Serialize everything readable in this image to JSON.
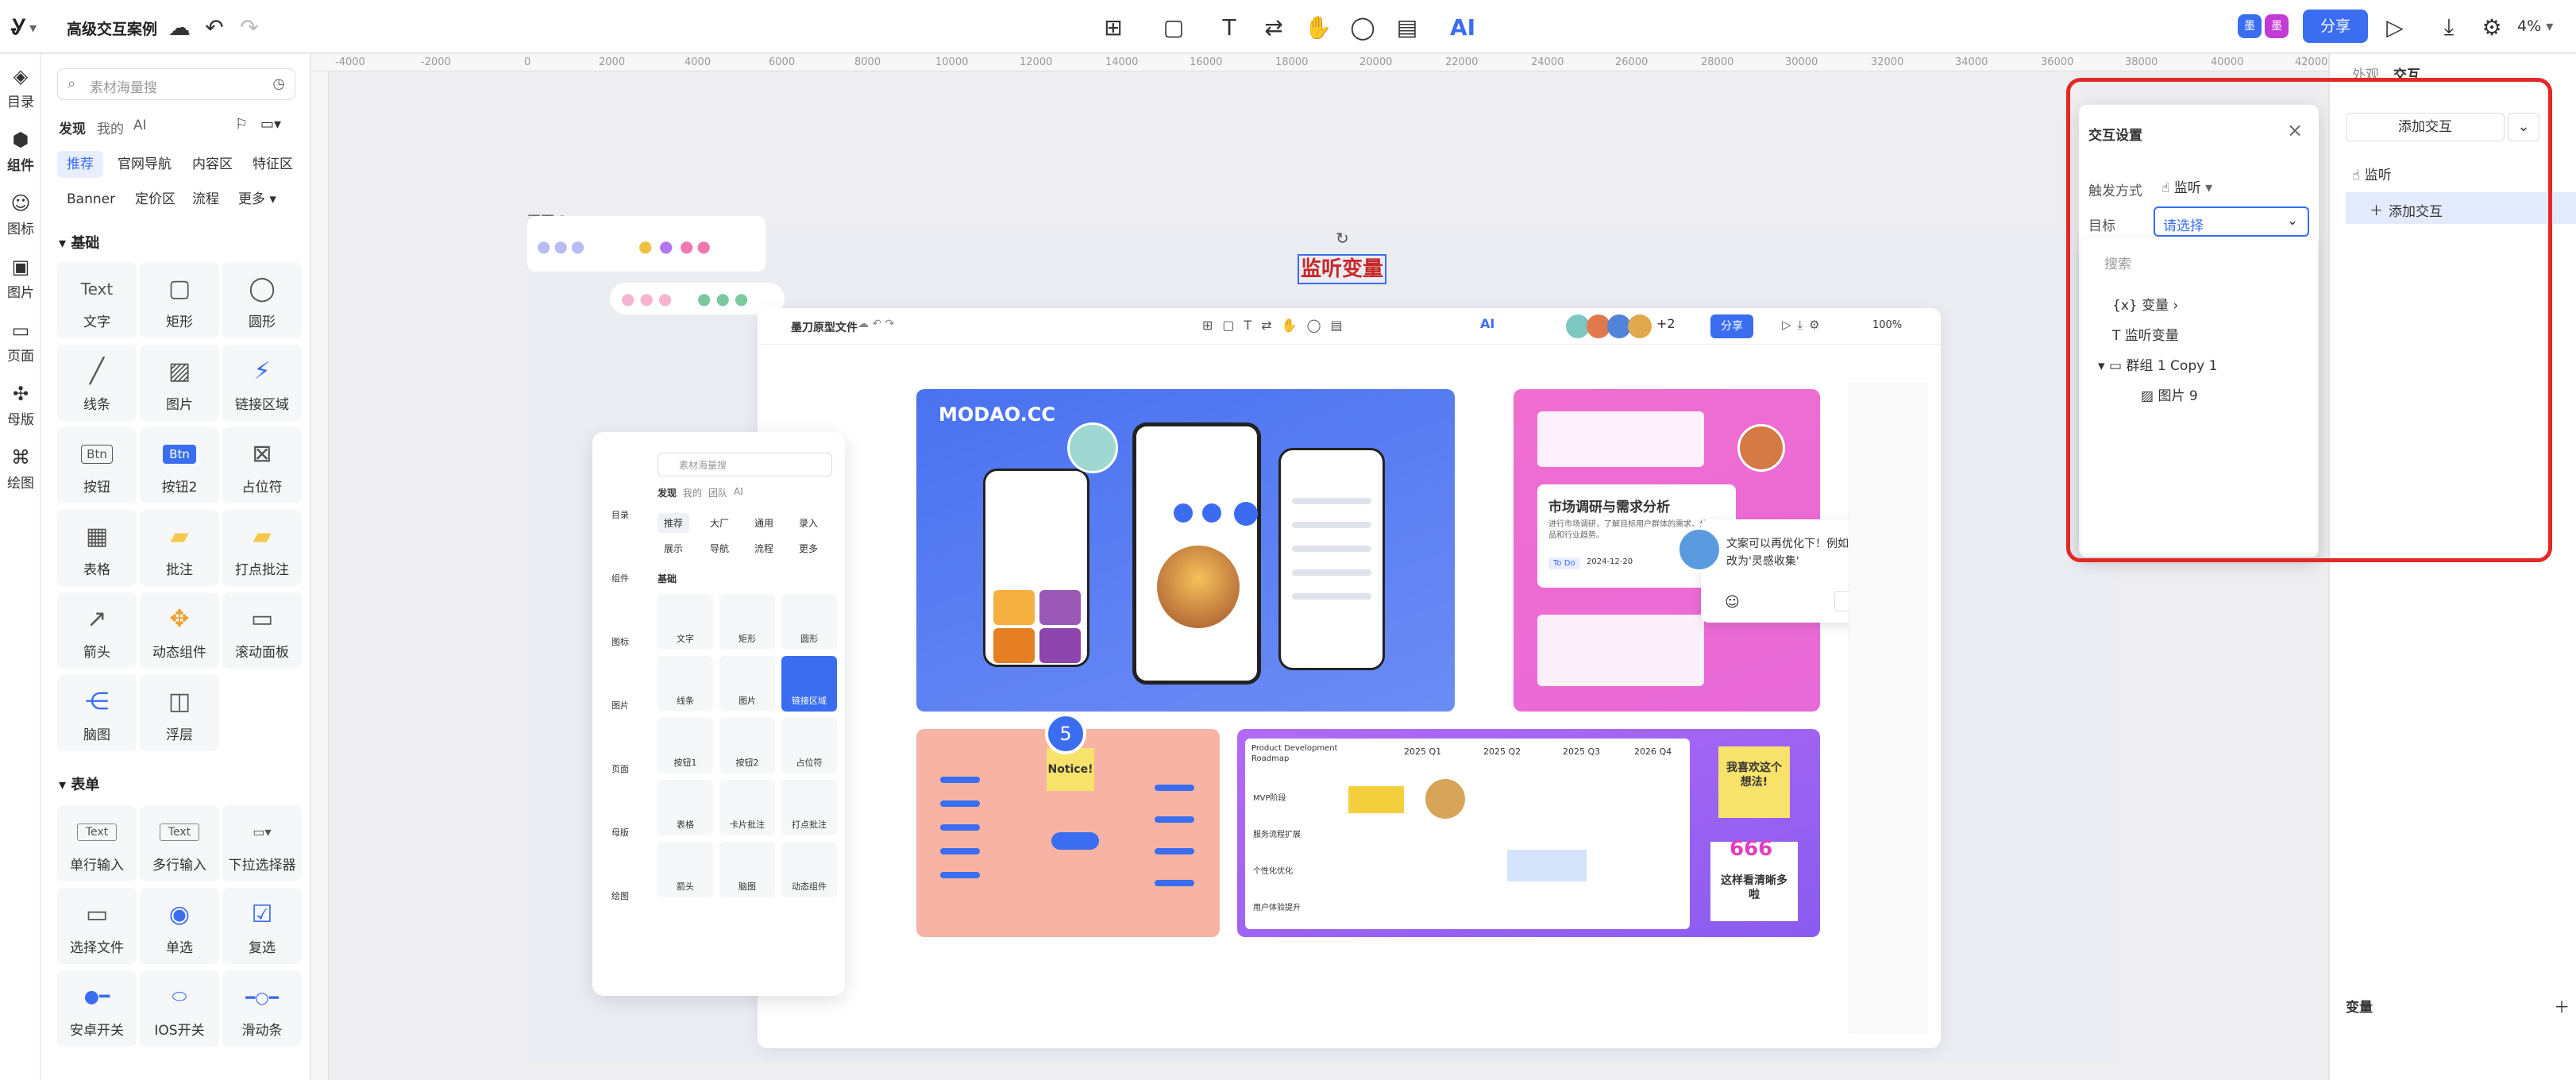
{
  "app": {
    "title": "高级交互案例",
    "share_label": "分享",
    "zoom": "4%",
    "avatar1": "墨",
    "avatar2": "墨"
  },
  "rail": [
    {
      "label": "目录",
      "icon": "layers-icon"
    },
    {
      "label": "组件",
      "icon": "component-icon"
    },
    {
      "label": "图标",
      "icon": "smiley-icon"
    },
    {
      "label": "图片",
      "icon": "image-icon"
    },
    {
      "label": "页面",
      "icon": "page-icon"
    },
    {
      "label": "母版",
      "icon": "master-icon"
    },
    {
      "label": "绘图",
      "icon": "draw-icon"
    }
  ],
  "library": {
    "search_placeholder": "素材海量搜",
    "tabs": [
      "发现",
      "我的",
      "AI"
    ],
    "chips_row1": [
      "推荐",
      "官网导航",
      "内容区",
      "特征区"
    ],
    "chips_row2": [
      "Banner",
      "定价区",
      "流程",
      "更多"
    ],
    "section_basic": "基础",
    "basic_items": [
      "文字",
      "矩形",
      "圆形",
      "线条",
      "图片",
      "链接区域",
      "按钮",
      "按钮2",
      "占位符",
      "表格",
      "批注",
      "打点批注",
      "箭头",
      "动态组件",
      "滚动面板",
      "脑图",
      "浮层"
    ],
    "section_form": "表单",
    "form_items": [
      "单行输入",
      "多行输入",
      "下拉选择器",
      "选择文件",
      "单选",
      "复选",
      "安卓开关",
      "IOS开关",
      "滑动条"
    ],
    "text_sample": "Text",
    "btn_sample": "Btn",
    "input_sample": "Text"
  },
  "ruler": [
    "-4000",
    "-2000",
    "0",
    "2000",
    "4000",
    "6000",
    "8000",
    "10000",
    "12000",
    "14000",
    "16000",
    "18000",
    "20000",
    "22000",
    "24000",
    "26000",
    "28000",
    "30000",
    "32000",
    "34000",
    "36000",
    "38000",
    "40000",
    "42000"
  ],
  "canvas": {
    "page_label": "页面 3",
    "var_label": "监听变量",
    "inner_title": "墨刀原型文件",
    "inner_share": "分享",
    "inner_zoom": "100%",
    "inner_more": "+2",
    "inner_search": "素材海量搜",
    "inner_tabs": [
      "发现",
      "我的",
      "团队",
      "AI"
    ],
    "inner_chips": [
      "推荐",
      "大厂",
      "通用",
      "录入",
      "展示",
      "导航",
      "流程",
      "更多"
    ],
    "inner_section": "基础",
    "inner_items": [
      "文字",
      "矩形",
      "圆形",
      "线条",
      "图片",
      "链接区域",
      "按钮1",
      "按钮2",
      "占位符",
      "表格",
      "卡片批注",
      "打点批注",
      "箭头",
      "脑图",
      "动态组件"
    ],
    "inner_rail": [
      "目录",
      "组件",
      "图标",
      "图片",
      "页面",
      "母版",
      "绘图"
    ],
    "modao": "MODAO.CC",
    "market_title": "市场调研与需求分析",
    "market_desc": "进行市场调研，了解目标用户群体的需求、分析竞品和行业趋势。",
    "market_tag": "To Do",
    "market_date": "2024-12-20",
    "comment": "文案可以再优化下！例如'发现'可以改为'灵感收集'",
    "badge_num": "5",
    "notice": "Notice!",
    "roadmap_title": "Product Development Roadmap",
    "roadmap_years": [
      "2025 Q1",
      "2025 Q2",
      "2025 Q3",
      "2026 Q4"
    ],
    "roadmap_rows": [
      "MVP阶段",
      "服务流程扩展",
      "个性化优化",
      "用户体验提升"
    ],
    "sticky1": "我喜欢这个想法!",
    "sticky2": "这样看清晰多啦",
    "sticky_num": "666"
  },
  "popup": {
    "title": "交互设置",
    "trigger_label": "触发方式",
    "trigger_value": "监听",
    "target_label": "目标",
    "target_value": "请选择",
    "search_placeholder": "搜索",
    "tree": [
      "变量",
      "监听变量",
      "群组 1 Copy 1",
      "图片 9"
    ]
  },
  "rpanel": {
    "tabs": [
      "外观",
      "交互"
    ],
    "add_label": "添加交互",
    "listen_label": "监听",
    "add_inner": "添加交互",
    "var_title": "变量"
  },
  "colors": {
    "accent": "#3a6df0",
    "red": "#e32828",
    "purple": "#7b56f5"
  }
}
